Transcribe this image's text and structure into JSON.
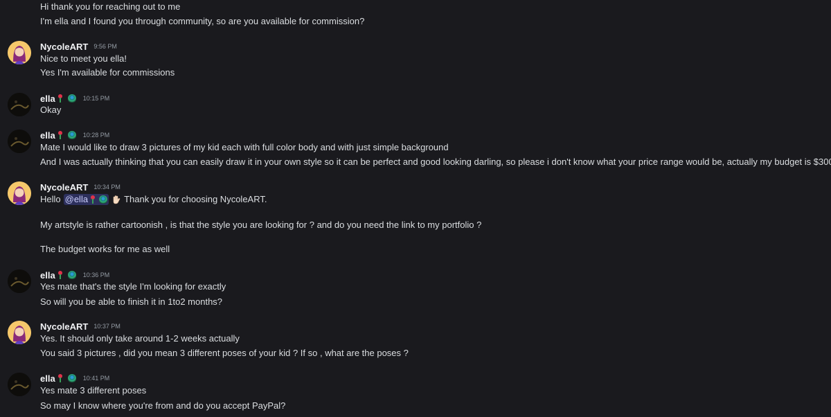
{
  "messages": {
    "m0": {
      "l1": "Hi thank you for reaching out to me",
      "l2": "I'm ella and I found you through community,  so are you available for commission?"
    },
    "m1": {
      "author": "NycoleART",
      "time": "9:56 PM",
      "l1": "Nice to meet you ella!",
      "l2": "Yes I'm available for commissions"
    },
    "m2": {
      "author": "ella",
      "time": "10:15 PM",
      "l1": "Okay"
    },
    "m3": {
      "author": "ella",
      "time": "10:28 PM",
      "l1": "Mate I would like to draw 3 pictures of my kid each with full color body and with just simple background",
      "l2": "And I was actually thinking that you can easily draw it in your own style so it can be perfect and good looking darling, so please i don't know what your price range would be, actually my budget is $300"
    },
    "m4": {
      "author": "NycoleART",
      "time": "10:34 PM",
      "l1_prefix": "Hello",
      "mention": "@ella",
      "l1_suffix": "Thank you for choosing NycoleART.",
      "l2": "My artstyle is rather cartoonish , is that the style you are looking for ? and do you need the link to my portfolio ?",
      "l3": "The budget works for me as well"
    },
    "m5": {
      "author": "ella",
      "time": "10:36 PM",
      "l1": "Yes mate that's the style I'm looking for exactly",
      "l2": "So will you be able to finish it in 1to2 months?"
    },
    "m6": {
      "author": "NycoleART",
      "time": "10:37 PM",
      "l1": "Yes. It should only take around 1-2 weeks actually",
      "l2": "You said 3 pictures , did you mean 3 different poses of your kid ? If so , what are the poses ?"
    },
    "m7": {
      "author": "ella",
      "time": "10:41 PM",
      "l1": "Yes mate 3 different poses",
      "l2": "So may I know where you're from and do you accept PayPal?"
    }
  },
  "icons": {
    "ella_badges": [
      "rose-emoji",
      "peacock-emoji"
    ],
    "wave": "waving-hand-emoji"
  },
  "colors": {
    "background": "#1a1a1e",
    "text": "#dbdee1",
    "author": "#f2f3f5",
    "timestamp": "#949ba4",
    "mention_bg": "#3b3f7a",
    "mention_text": "#c9cdfb"
  }
}
